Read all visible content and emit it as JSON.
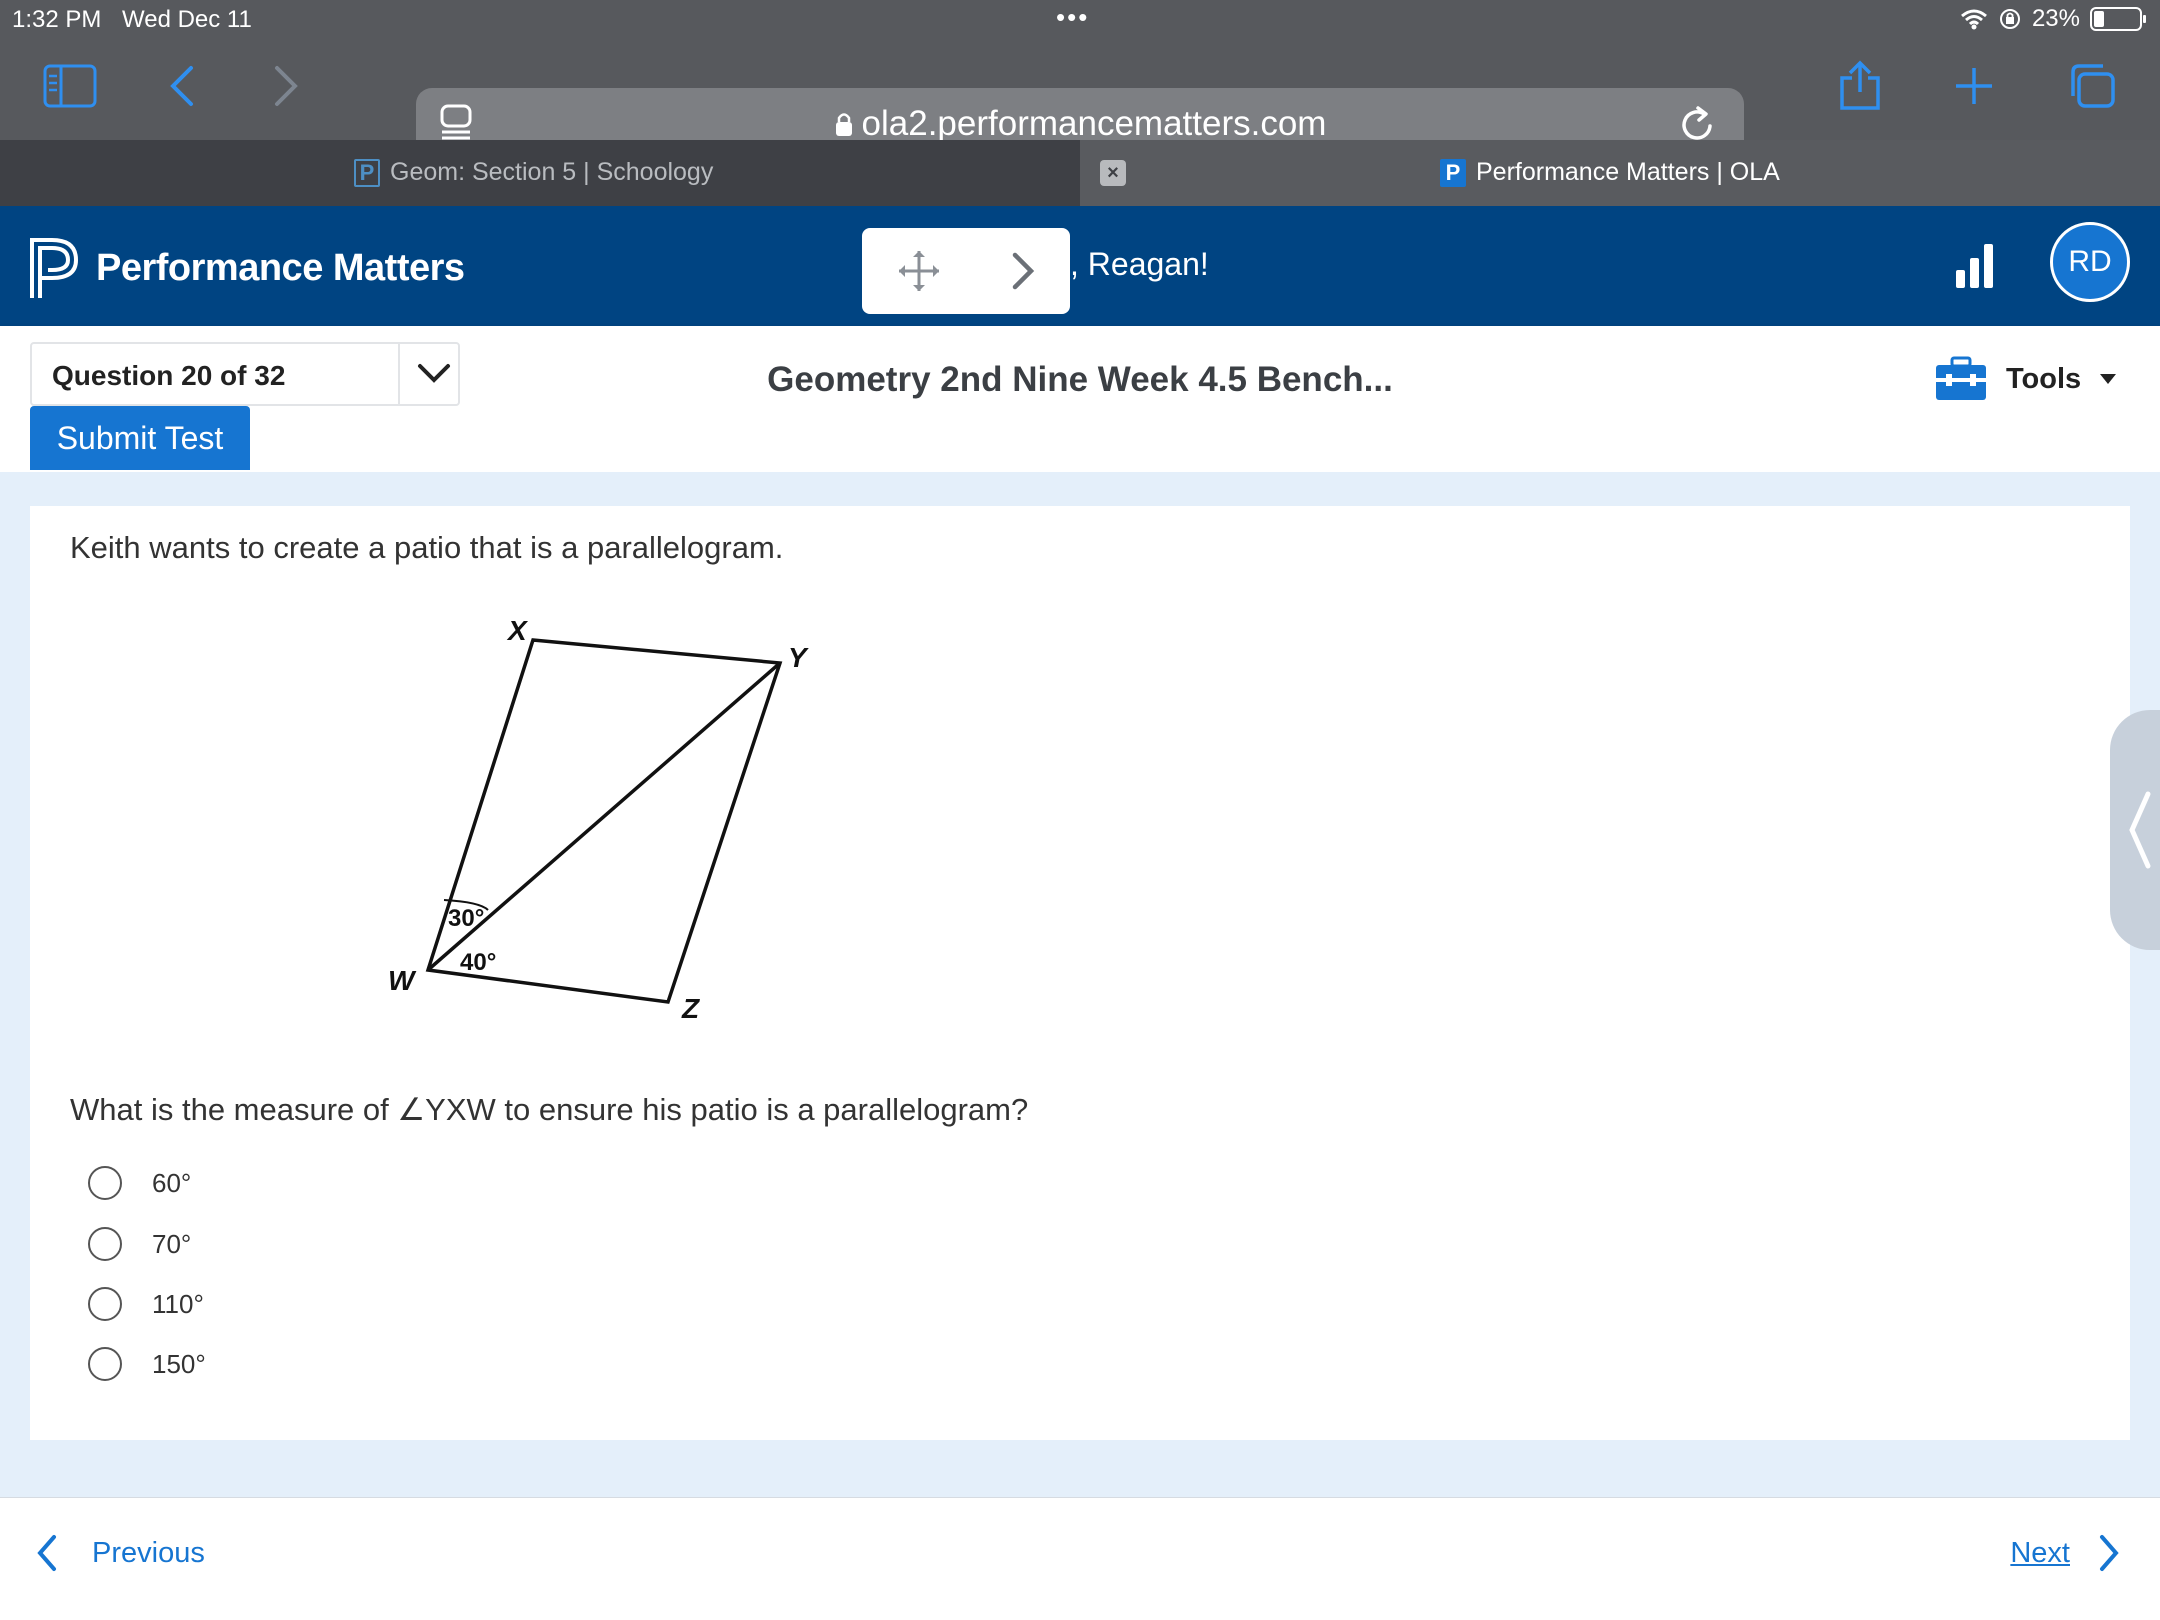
{
  "status_bar": {
    "time": "1:32 PM",
    "date": "Wed Dec 11",
    "battery": "23%"
  },
  "browser": {
    "url": "ola2.performancematters.com",
    "tabs": [
      {
        "title": "Geom: Section 5 | Schoology",
        "active": false
      },
      {
        "title": "Performance Matters | OLA",
        "active": true
      }
    ]
  },
  "app": {
    "brand": "Performance Matters",
    "greeting": ", Reagan!",
    "avatar_initials": "RD",
    "brand_color": "#004482",
    "accent_color": "#1675d1"
  },
  "question_bar": {
    "question_selector": "Question 20 of 32",
    "submit_label": "Submit Test",
    "test_title": "Geometry 2nd Nine Week 4.5 Bench...",
    "tools_label": "Tools"
  },
  "question": {
    "stem": "Keith wants to create a patio that is a parallelogram.",
    "figure": {
      "vertices": {
        "x": "X",
        "y": "Y",
        "w": "W",
        "z": "Z"
      },
      "angle_upper": "30°",
      "angle_lower": "40°"
    },
    "prompt": "What is the measure of ∠YXW  to ensure his patio is a parallelogram?",
    "choices": [
      "60°",
      "70°",
      "110°",
      "150°"
    ]
  },
  "footer": {
    "previous_label": "Previous",
    "next_label": "Next"
  }
}
